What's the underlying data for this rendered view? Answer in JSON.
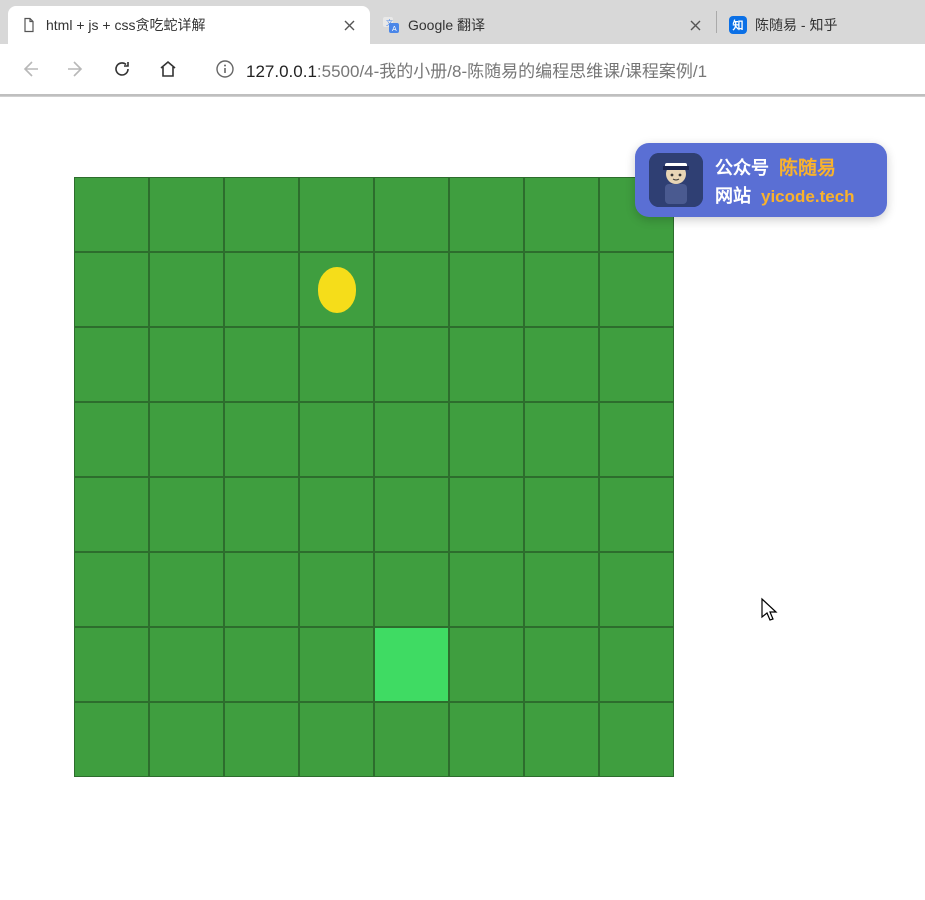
{
  "tabs": [
    {
      "title": "html + js + css贪吃蛇详解",
      "active": true,
      "favicon": "file-icon",
      "closable": true
    },
    {
      "title": "Google 翻译",
      "active": false,
      "favicon": "gtranslate-icon",
      "closable": true
    },
    {
      "title": "陈随易 - 知乎",
      "active": false,
      "favicon": "zhihu-icon",
      "closable": false
    }
  ],
  "addressbar": {
    "host": "127.0.0.1",
    "path": ":5500/4-我的小册/8-陈随易的编程思维课/课程案例/1"
  },
  "game": {
    "grid_size": 8,
    "food": {
      "row": 1,
      "col": 3
    },
    "snake_head": {
      "row": 6,
      "col": 4
    }
  },
  "badge": {
    "line1_label": "公众号",
    "line1_value": "陈随易",
    "line2_label": "网站",
    "line2_value": "yicode.tech"
  },
  "zhihu_glyph": "知"
}
